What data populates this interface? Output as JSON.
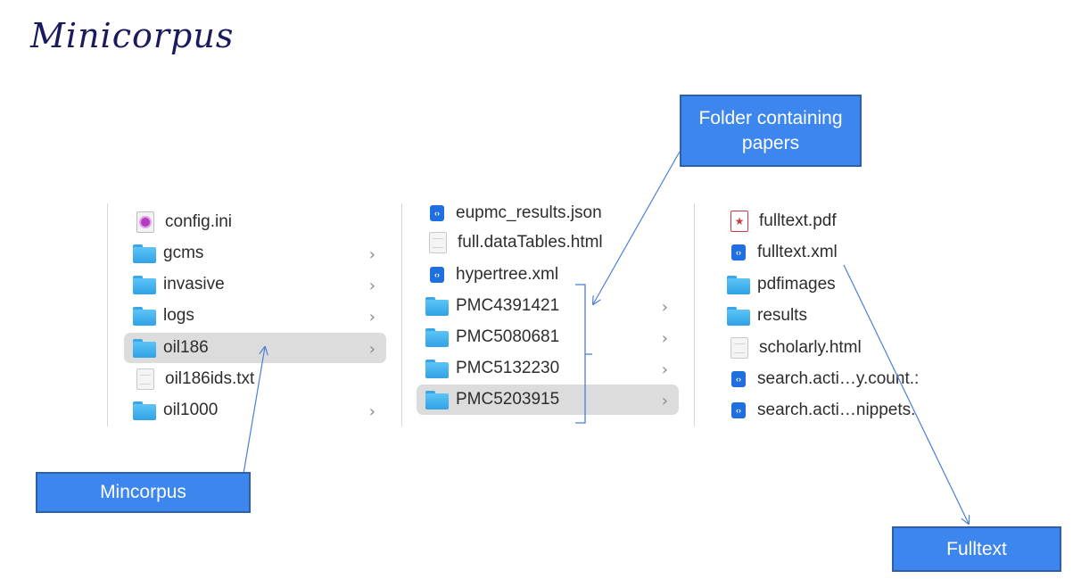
{
  "title": "Minicorpus",
  "col1": {
    "items": [
      {
        "name": "config.ini",
        "icon": "config-file-icon",
        "chevron": false,
        "selected": false
      },
      {
        "name": "gcms",
        "icon": "folder-icon",
        "chevron": true,
        "selected": false
      },
      {
        "name": "invasive",
        "icon": "folder-icon",
        "chevron": true,
        "selected": false
      },
      {
        "name": "logs",
        "icon": "folder-icon",
        "chevron": true,
        "selected": false
      },
      {
        "name": "oil186",
        "icon": "folder-icon",
        "chevron": true,
        "selected": true
      },
      {
        "name": "oil186ids.txt",
        "icon": "document-icon",
        "chevron": false,
        "selected": false
      },
      {
        "name": "oil1000",
        "icon": "folder-icon",
        "chevron": true,
        "selected": false
      }
    ]
  },
  "col2": {
    "items": [
      {
        "name": "eupmc_results.json",
        "icon": "code-file-icon",
        "chevron": false,
        "selected": false
      },
      {
        "name": "full.dataTables.html",
        "icon": "document-icon",
        "chevron": false,
        "selected": false
      },
      {
        "name": "hypertree.xml",
        "icon": "code-file-icon",
        "chevron": false,
        "selected": false
      },
      {
        "name": "PMC4391421",
        "icon": "folder-icon",
        "chevron": true,
        "selected": false
      },
      {
        "name": "PMC5080681",
        "icon": "folder-icon",
        "chevron": true,
        "selected": false
      },
      {
        "name": "PMC5132230",
        "icon": "folder-icon",
        "chevron": true,
        "selected": false
      },
      {
        "name": "PMC5203915",
        "icon": "folder-icon",
        "chevron": true,
        "selected": true
      }
    ]
  },
  "col3": {
    "items": [
      {
        "name": "fulltext.pdf",
        "icon": "pdf-file-icon",
        "chevron": false,
        "selected": false
      },
      {
        "name": "fulltext.xml",
        "icon": "code-file-icon",
        "chevron": false,
        "selected": false
      },
      {
        "name": "pdfimages",
        "icon": "folder-icon",
        "chevron": false,
        "selected": false
      },
      {
        "name": "results",
        "icon": "folder-icon",
        "chevron": false,
        "selected": false
      },
      {
        "name": "scholarly.html",
        "icon": "document-icon",
        "chevron": false,
        "selected": false
      },
      {
        "name": "search.acti…y.count.:",
        "icon": "code-file-icon",
        "chevron": false,
        "selected": false
      },
      {
        "name": "search.acti…nippets.",
        "icon": "code-file-icon",
        "chevron": false,
        "selected": false
      }
    ]
  },
  "callouts": {
    "folder": "Folder containing papers",
    "mincorpus": "Mincorpus",
    "fulltext": "Fulltext"
  },
  "colors": {
    "callout_fill": "#3c86ee",
    "callout_border": "#2f5fa8",
    "arrow": "#4a7fd8",
    "folder": "#3aa6e8",
    "selection": "#dcdcdc",
    "title": "#1a1a5e"
  }
}
